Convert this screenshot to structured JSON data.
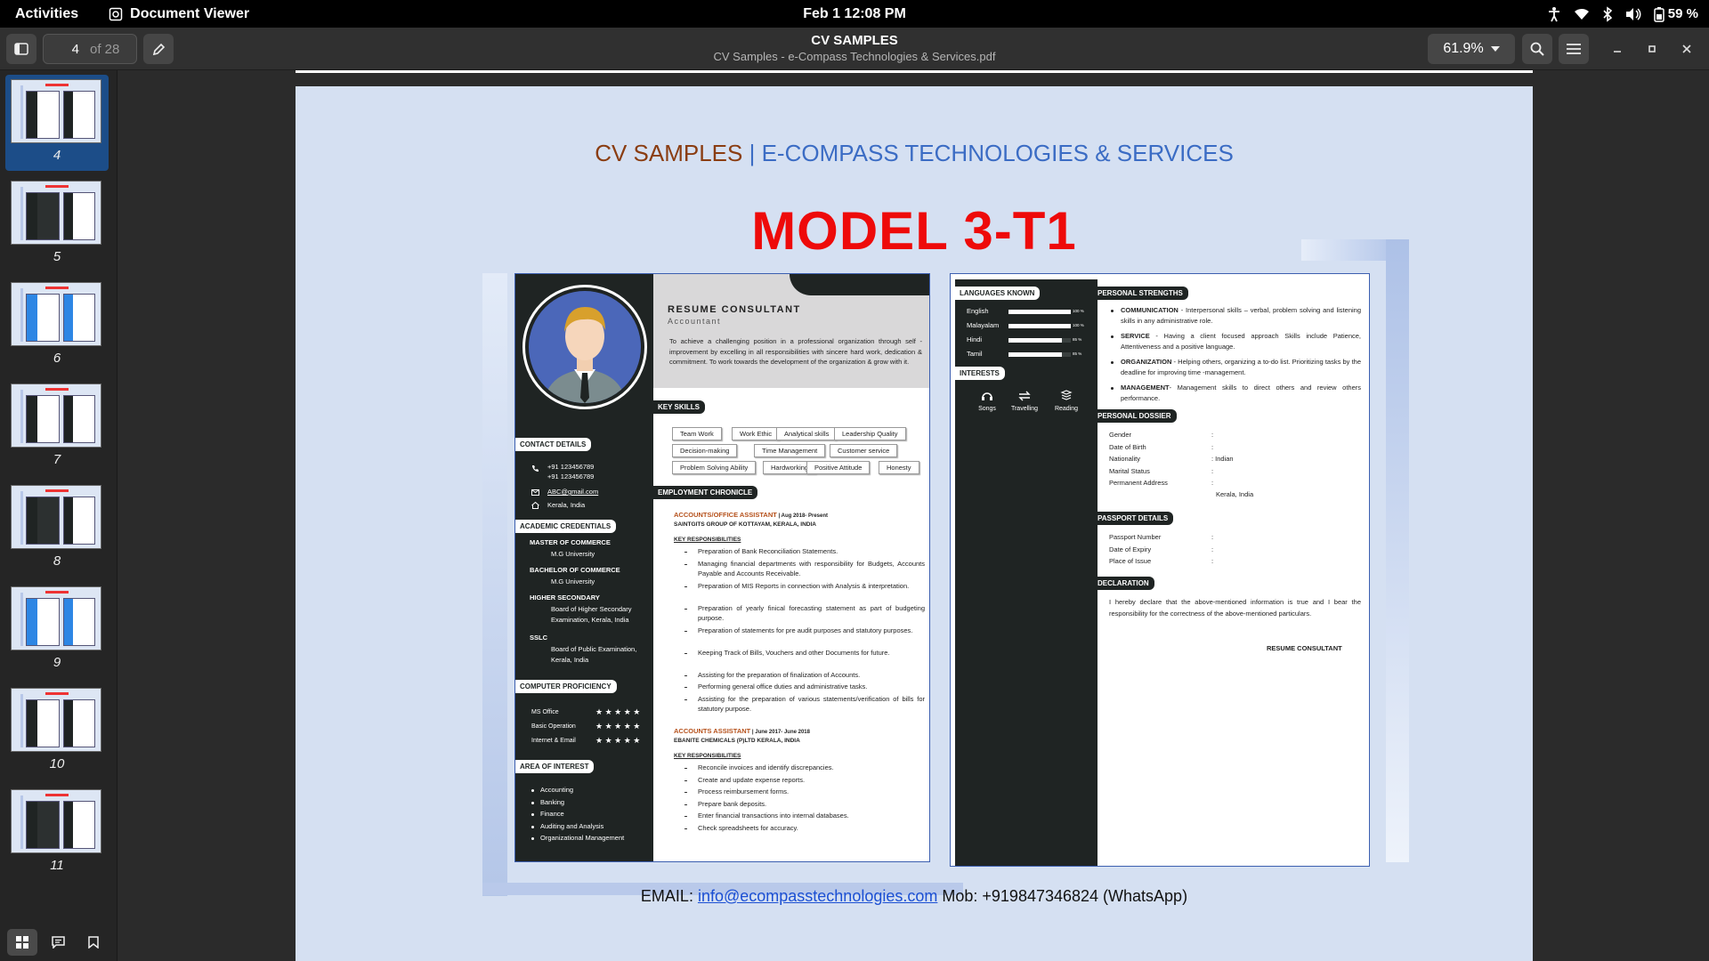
{
  "topbar": {
    "activities": "Activities",
    "app_name": "Document Viewer",
    "clock": "Feb 1  12:08 PM",
    "battery": "59 %"
  },
  "header": {
    "page_current": "4",
    "page_total": "of 28",
    "title": "CV SAMPLES",
    "subtitle": "CV Samples - e-Compass Technologies & Services.pdf",
    "zoom": "61.9%"
  },
  "thumbnails": [
    {
      "label": "4",
      "selected": true
    },
    {
      "label": "5",
      "selected": false
    },
    {
      "label": "6",
      "selected": false
    },
    {
      "label": "7",
      "selected": false
    },
    {
      "label": "8",
      "selected": false
    },
    {
      "label": "9",
      "selected": false
    },
    {
      "label": "10",
      "selected": false
    },
    {
      "label": "11",
      "selected": false
    }
  ],
  "page": {
    "heading_left": "CV SAMPLES",
    "heading_sep": " | ",
    "heading_right": "E-COMPASS TECHNOLOGIES & SERVICES",
    "model": "MODEL 3-T1",
    "footer_email_label": "EMAIL: ",
    "footer_email": "info@ecompasstechnologies.com",
    "footer_mob": " Mob: +919847346824 (WhatsApp)"
  },
  "cv_left": {
    "name": "RESUME CONSULTANT",
    "role": "Accountant",
    "objective": "To achieve a challenging position in a professional organization through self - improvement by excelling in all responsibilities with sincere hard work, dedication & commitment. To work towards the development of the organization & grow with it.",
    "key_skills_title": "KEY SKILLS",
    "skills": [
      "Team Work",
      "Work Ethic",
      "Analytical skills",
      "Leadership Quality",
      "Decision-making",
      "Time Management",
      "Customer service",
      "Problem Solving Ability",
      "Hardworking",
      "Positive Attitude",
      "Honesty"
    ],
    "contact_title": "CONTACT DETAILS",
    "phone1": "+91 123456789",
    "phone2": "+91 123456789",
    "email": "ABC@gmail.com",
    "location": "Kerala, India",
    "academic_title": "ACADEMIC CREDENTIALS",
    "degrees": [
      {
        "name": "MASTER OF COMMERCE",
        "board1": "M.G University",
        "board2": ""
      },
      {
        "name": "BACHELOR OF COMMERCE",
        "board1": "M.G University",
        "board2": ""
      },
      {
        "name": "HIGHER SECONDARY",
        "board1": "Board of Higher Secondary",
        "board2": "Examination, Kerala, India"
      },
      {
        "name": "SSLC",
        "board1": "Board of Public Examination,",
        "board2": "Kerala, India"
      }
    ],
    "computer_title": "COMPUTER PROFICIENCY",
    "computer": [
      {
        "name": "MS Office",
        "stars": "★ ★ ★ ★ ★"
      },
      {
        "name": "Basic Operation",
        "stars": "★ ★ ★ ★ ★"
      },
      {
        "name": "Internet & Email",
        "stars": "★ ★ ★ ★ ★"
      }
    ],
    "interest_title": "AREA OF INTEREST",
    "interests": [
      "Accounting",
      "Banking",
      "Finance",
      "Auditing and Analysis",
      "Organizational Management"
    ],
    "employment_title": "EMPLOYMENT CHRONICLE",
    "job1_title": "ACCOUNTS/OFFICE ASSISTANT",
    "job1_date": " | Aug 2018- Present",
    "job1_company": "SAINTGITS GROUP OF KOTTAYAM, KERALA, INDIA",
    "job1_resp_title": "KEY RESPONSIBILITIES",
    "job1_resp": [
      "Preparation of Bank Reconciliation Statements.",
      "Managing financial departments with responsibility for Budgets, Accounts Payable and Accounts Receivable.",
      "Preparation of MIS Reports in connection with Analysis & interpretation.",
      "Preparation of yearly finical forecasting statement as part of budgeting purpose.",
      "Preparation of statements for pre audit purposes and statutory purposes.",
      "Keeping Track of Bills, Vouchers and other Documents for future.",
      "Assisting for the preparation of finalization of Accounts.",
      "Performing general office duties and administrative tasks.",
      "Assisting for the preparation of various statements/verification of bills for statutory purpose."
    ],
    "job2_title": "ACCOUNTS ASSISTANT",
    "job2_date": " | June 2017- June 2018",
    "job2_company": "EBANITE CHEMICALS (P)LTD KERALA, INDIA",
    "job2_resp_title": "KEY RESPONSIBILITIES",
    "job2_resp": [
      "Reconcile invoices and identify discrepancies.",
      "Create and update expense reports.",
      "Process reimbursement forms.",
      "Prepare bank deposits.",
      "Enter financial transactions into internal databases.",
      "Check spreadsheets for accuracy."
    ]
  },
  "cv_right": {
    "languages_title": "LANGUAGES KNOWN",
    "languages": [
      {
        "name": "English",
        "pct": "100 %",
        "level": 1.0
      },
      {
        "name": "Malayalam",
        "pct": "100 %",
        "level": 1.0
      },
      {
        "name": "Hindi",
        "pct": "85 %",
        "level": 0.85
      },
      {
        "name": "Tamil",
        "pct": "85 %",
        "level": 0.85
      }
    ],
    "interests_title": "INTERESTS",
    "interests": [
      {
        "icon": "headphones-icon",
        "label": "Songs"
      },
      {
        "icon": "travel-arrows-icon",
        "label": "Travelling"
      },
      {
        "icon": "book-stack-icon",
        "label": "Reading"
      }
    ],
    "strengths_title": "PERSONAL STRENGTHS",
    "strengths": [
      {
        "head": "COMMUNICATION",
        "text": " - Interpersonal skills – verbal, problem solving and listening skills in any administrative role."
      },
      {
        "head": "SERVICE",
        "text": " - Having a client focused approach Skills include Patience, Attentiveness and a positive language."
      },
      {
        "head": "ORGANIZATION",
        "text": " - Helping others, organizing a to-do list. Prioritizing tasks by the deadline for improving time -management."
      },
      {
        "head": "MANAGEMENT",
        "text": "- Management skills to direct others and review others performance."
      }
    ],
    "dossier_title": "PERSONAL DOSSIER",
    "dossier": [
      {
        "label": "Gender",
        "value": ":"
      },
      {
        "label": "Date of Birth",
        "value": ":"
      },
      {
        "label": "Nationality",
        "value": ": Indian"
      },
      {
        "label": "Marital Status",
        "value": ":"
      },
      {
        "label": "Permanent Address",
        "value": ":"
      }
    ],
    "address_line": "Kerala, India",
    "passport_title": "PASSPORT DETAILS",
    "passport": [
      {
        "label": "Passport Number",
        "value": ":"
      },
      {
        "label": "Date of Expiry",
        "value": ":"
      },
      {
        "label": "Place of Issue",
        "value": ":"
      }
    ],
    "declaration_title": "DECLARATION",
    "declaration": "I hereby declare that the above-mentioned information is true and I bear the responsibility for the correctness of the above-mentioned particulars.",
    "signature": "RESUME CONSULTANT"
  }
}
